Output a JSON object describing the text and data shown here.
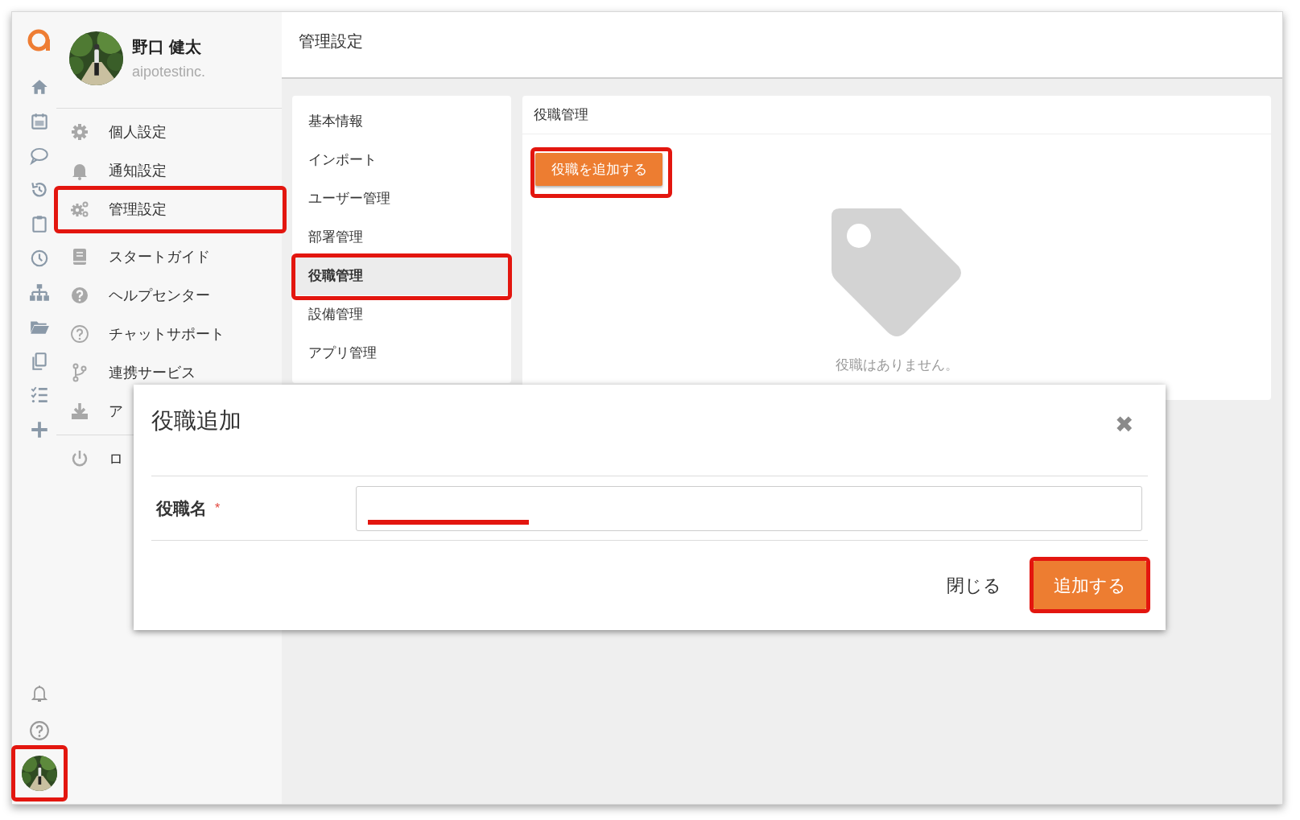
{
  "profile": {
    "name": "野口 健太",
    "company": "aipotestinc."
  },
  "sidebar": {
    "groups": [
      {
        "items": [
          {
            "label": "個人設定",
            "highlighted": false
          },
          {
            "label": "通知設定",
            "highlighted": false
          },
          {
            "label": "管理設定",
            "highlighted": true
          }
        ]
      },
      {
        "items": [
          {
            "label": "スタートガイド",
            "highlighted": false
          },
          {
            "label": "ヘルプセンター",
            "highlighted": false
          },
          {
            "label": "チャットサポート",
            "highlighted": false
          },
          {
            "label": "連携サービス",
            "highlighted": false
          },
          {
            "label": "ア",
            "highlighted": false
          }
        ]
      },
      {
        "items": [
          {
            "label": "ロ",
            "highlighted": false
          }
        ]
      }
    ]
  },
  "rail": {
    "user_avatar": {
      "highlighted": true
    }
  },
  "header": {
    "title": "管理設定"
  },
  "settings_menu": {
    "items": [
      {
        "label": "基本情報",
        "selected": false,
        "highlighted": false
      },
      {
        "label": "インポート",
        "selected": false,
        "highlighted": false
      },
      {
        "label": "ユーザー管理",
        "selected": false,
        "highlighted": false
      },
      {
        "label": "部署管理",
        "selected": false,
        "highlighted": false
      },
      {
        "label": "役職管理",
        "selected": true,
        "highlighted": true
      },
      {
        "label": "設備管理",
        "selected": false,
        "highlighted": false
      },
      {
        "label": "アプリ管理",
        "selected": false,
        "highlighted": false
      }
    ]
  },
  "panel": {
    "title": "役職管理",
    "add_button": {
      "label": "役職を追加する",
      "highlighted": true
    },
    "empty_message": "役職はありません。"
  },
  "dialog": {
    "title": "役職追加",
    "close": "✖",
    "field": {
      "label": "役職名",
      "required_mark": "*",
      "highlighted": true
    },
    "buttons": [
      {
        "label": "閉じる",
        "kind": "text",
        "highlighted": false
      },
      {
        "label": "追加する",
        "kind": "primary",
        "highlighted": true
      }
    ]
  }
}
